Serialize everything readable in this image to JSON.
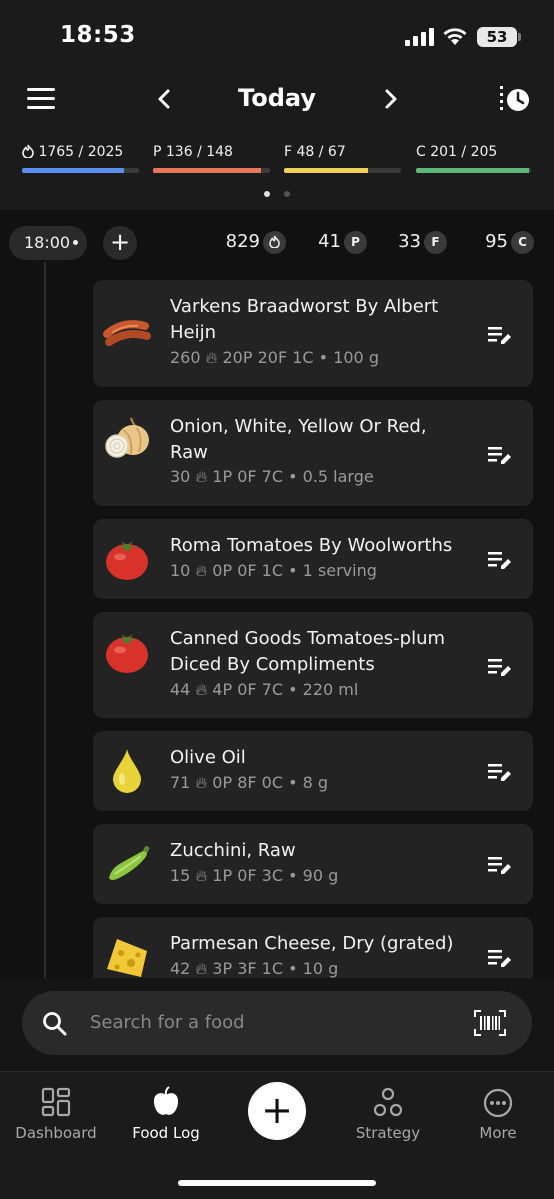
{
  "status_bar": {
    "time": "18:53",
    "battery": "53"
  },
  "header": {
    "title": "Today",
    "macros": [
      {
        "key": "calories",
        "label": "1765 / 2025",
        "icon": "flame-icon",
        "progress": 0.87,
        "color": "#5b8def"
      },
      {
        "key": "protein",
        "label": "P 136 / 148",
        "progress": 0.92,
        "color": "#e9785a"
      },
      {
        "key": "fat",
        "label": "F 48 / 67",
        "progress": 0.72,
        "color": "#f2cf5b"
      },
      {
        "key": "carbs",
        "label": "C 201 / 205",
        "progress": 0.98,
        "color": "#5fb878"
      }
    ],
    "page_dots": {
      "count": 2,
      "active": 0
    }
  },
  "meal": {
    "time": "18:00",
    "totals": {
      "calories": "829",
      "protein": "41",
      "fat": "33",
      "carbs": "95"
    },
    "badges": {
      "protein": "P",
      "fat": "F",
      "carbs": "C"
    }
  },
  "foods": [
    {
      "icon": "sausage-icon",
      "name": "Varkens Braadworst By Albert Heijn",
      "cal": "260",
      "stats": "20P   20F   1C  •  100 g"
    },
    {
      "icon": "onion-icon",
      "name": "Onion, White, Yellow Or Red, Raw",
      "cal": "30",
      "stats": "1P   0F   7C  •  0.5 large"
    },
    {
      "icon": "tomato-icon",
      "name": "Roma Tomatoes By Woolworths",
      "cal": "10",
      "stats": "0P   0F   1C  •  1 serving"
    },
    {
      "icon": "tomato-icon",
      "name": "Canned Goods Tomatoes-plum Diced By Compliments",
      "cal": "44",
      "stats": "4P   0F   7C  •  220 ml"
    },
    {
      "icon": "oil-drop-icon",
      "name": "Olive Oil",
      "cal": "71",
      "stats": "0P   8F   0C  •  8 g"
    },
    {
      "icon": "zucchini-icon",
      "name": "Zucchini, Raw",
      "cal": "15",
      "stats": "1P   0F   3C  •  90 g"
    },
    {
      "icon": "cheese-icon",
      "name": "Parmesan Cheese, Dry (grated)",
      "cal": "42",
      "stats": "3P   3F   1C  •  10 g"
    }
  ],
  "search": {
    "placeholder": "Search for a food"
  },
  "tabs": [
    {
      "label": "Dashboard",
      "icon": "dashboard-icon"
    },
    {
      "label": "Food Log",
      "icon": "apple-icon",
      "active": true
    },
    {
      "label": "Strategy",
      "icon": "strategy-icon"
    },
    {
      "label": "More",
      "icon": "more-icon"
    }
  ]
}
